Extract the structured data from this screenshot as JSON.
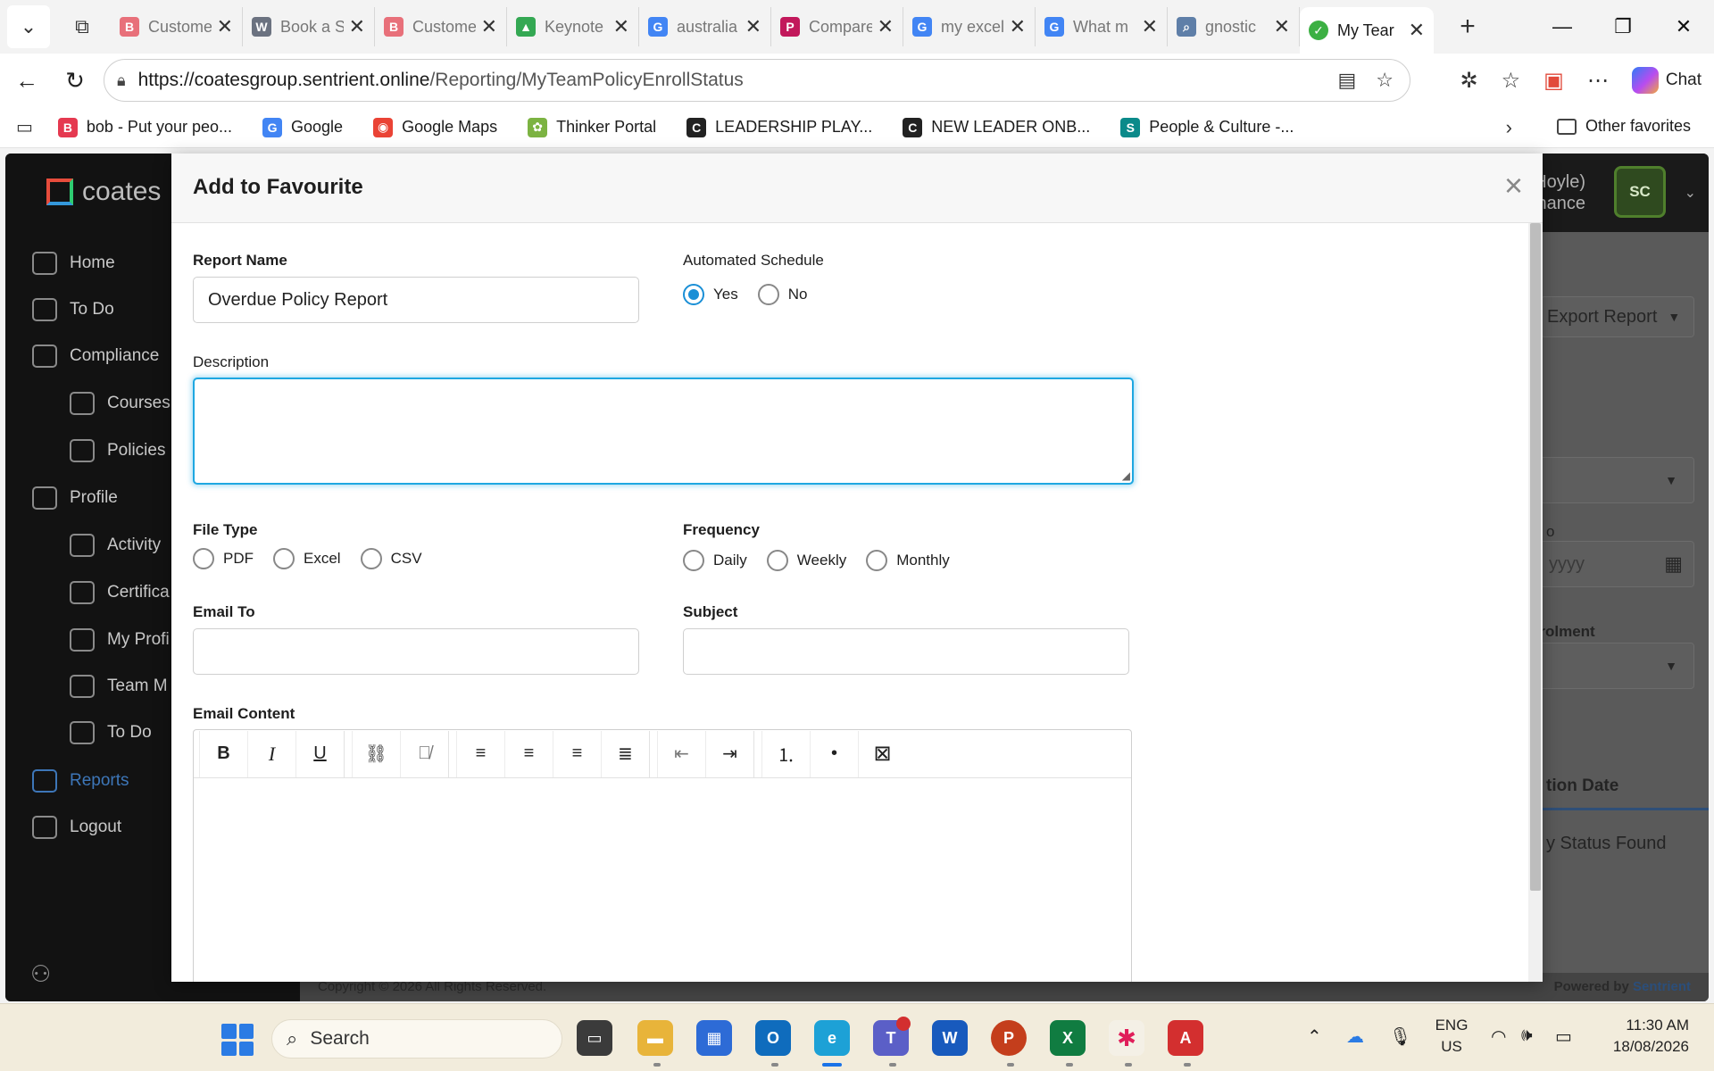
{
  "browser": {
    "tabs": [
      {
        "title": "Customer",
        "favicon_color": "#e8707a",
        "favicon_letter": "B"
      },
      {
        "title": "Book a Se",
        "favicon_color": "#6b7280",
        "favicon_letter": "W"
      },
      {
        "title": "Customer",
        "favicon_color": "#e8707a",
        "favicon_letter": "B"
      },
      {
        "title": "Keynote",
        "favicon_color": "#34a853",
        "favicon_letter": "▲"
      },
      {
        "title": "australia",
        "favicon_color": "#4285f4",
        "favicon_letter": "G"
      },
      {
        "title": "Compare",
        "favicon_color": "#c2185b",
        "favicon_letter": "P"
      },
      {
        "title": "my excel",
        "favicon_color": "#4285f4",
        "favicon_letter": "G"
      },
      {
        "title": "What m",
        "favicon_color": "#4285f4",
        "favicon_letter": "G"
      },
      {
        "title": "gnostic",
        "favicon_color": "#5f7fa8",
        "favicon_letter": "⌕"
      }
    ],
    "active_tab": {
      "title": "My Tear",
      "favicon_color": "#3cb043"
    },
    "url_host": "https://coatesgroup.sentrient.online",
    "url_path": "/Reporting/MyTeamPolicyEnrollStatus",
    "copilot_label": "Chat",
    "favorites": [
      {
        "label": "bob - Put your peo...",
        "icon_color": "#e53950",
        "icon_letter": "B"
      },
      {
        "label": "Google",
        "icon_color": "#4285f4",
        "icon_letter": "G"
      },
      {
        "label": "Google Maps",
        "icon_color": "#ea4335",
        "icon_letter": "◉"
      },
      {
        "label": "Thinker Portal",
        "icon_color": "#7cb342",
        "icon_letter": "✿"
      },
      {
        "label": "LEADERSHIP PLAY...",
        "icon_color": "#222222",
        "icon_letter": "C"
      },
      {
        "label": "NEW LEADER ONB...",
        "icon_color": "#222222",
        "icon_letter": "C"
      },
      {
        "label": "People & Culture -...",
        "icon_color": "#0b8a8a",
        "icon_letter": "S"
      }
    ],
    "other_favorites": "Other favorites"
  },
  "app": {
    "brand": "coates",
    "user_name_line1": "Hoyle)",
    "user_name_line2": "inance",
    "avatar_initials": "SC",
    "sidebar": [
      {
        "label": "Home",
        "indent": false
      },
      {
        "label": "To Do",
        "indent": false
      },
      {
        "label": "Compliance",
        "indent": false
      },
      {
        "label": "Courses",
        "indent": true
      },
      {
        "label": "Policies",
        "indent": true
      },
      {
        "label": "Profile",
        "indent": false
      },
      {
        "label": "Activity",
        "indent": true
      },
      {
        "label": "Certifica",
        "indent": true
      },
      {
        "label": "My Profi",
        "indent": true
      },
      {
        "label": "Team M",
        "indent": true
      },
      {
        "label": "To Do",
        "indent": true
      },
      {
        "label": "Reports",
        "indent": false,
        "active": true
      },
      {
        "label": "Logout",
        "indent": false
      }
    ],
    "export_button": "Export Report",
    "date_label_partial": "o",
    "date_placeholder_partial": "yyyy",
    "enrolment_label_partial": "nrolment",
    "col_header_partial": "tion Date",
    "empty_row_partial": "y Status Found",
    "footer_copyright": "Copyright © 2026 All Rights Reserved.",
    "powered_by_prefix": "Powered by ",
    "powered_by_brand": "Sentrient"
  },
  "modal": {
    "title": "Add to Favourite",
    "close_glyph": "×",
    "report_name_label": "Report Name",
    "report_name_value": "Overdue Policy Report",
    "automated_schedule_label": "Automated Schedule",
    "schedule_options": [
      {
        "label": "Yes",
        "selected": true
      },
      {
        "label": "No",
        "selected": false
      }
    ],
    "description_label": "Description",
    "description_value": "",
    "file_type_label": "File Type",
    "file_type_options": [
      {
        "label": "PDF",
        "selected": false
      },
      {
        "label": "Excel",
        "selected": false
      },
      {
        "label": "CSV",
        "selected": false
      }
    ],
    "frequency_label": "Frequency",
    "frequency_options": [
      {
        "label": "Daily",
        "selected": false
      },
      {
        "label": "Weekly",
        "selected": false
      },
      {
        "label": "Monthly",
        "selected": false
      }
    ],
    "email_to_label": "Email To",
    "email_to_value": "",
    "subject_label": "Subject",
    "subject_value": "",
    "email_content_label": "Email Content",
    "editor_tools": {
      "bold": "B",
      "italic": "I",
      "underline": "U",
      "link": "⛓",
      "unlink": "⛓̸",
      "align_left": "≡",
      "align_center": "≡",
      "align_right": "≡",
      "justify": "≣",
      "outdent": "⇤",
      "indent": "⇥",
      "ordered_list": "⒈",
      "bullet_list": "•",
      "remove_format": "⊠"
    }
  },
  "taskbar": {
    "search_label": "Search",
    "language_line1": "ENG",
    "language_line2": "US",
    "time": "11:30 AM",
    "date": "18/08/2026"
  }
}
